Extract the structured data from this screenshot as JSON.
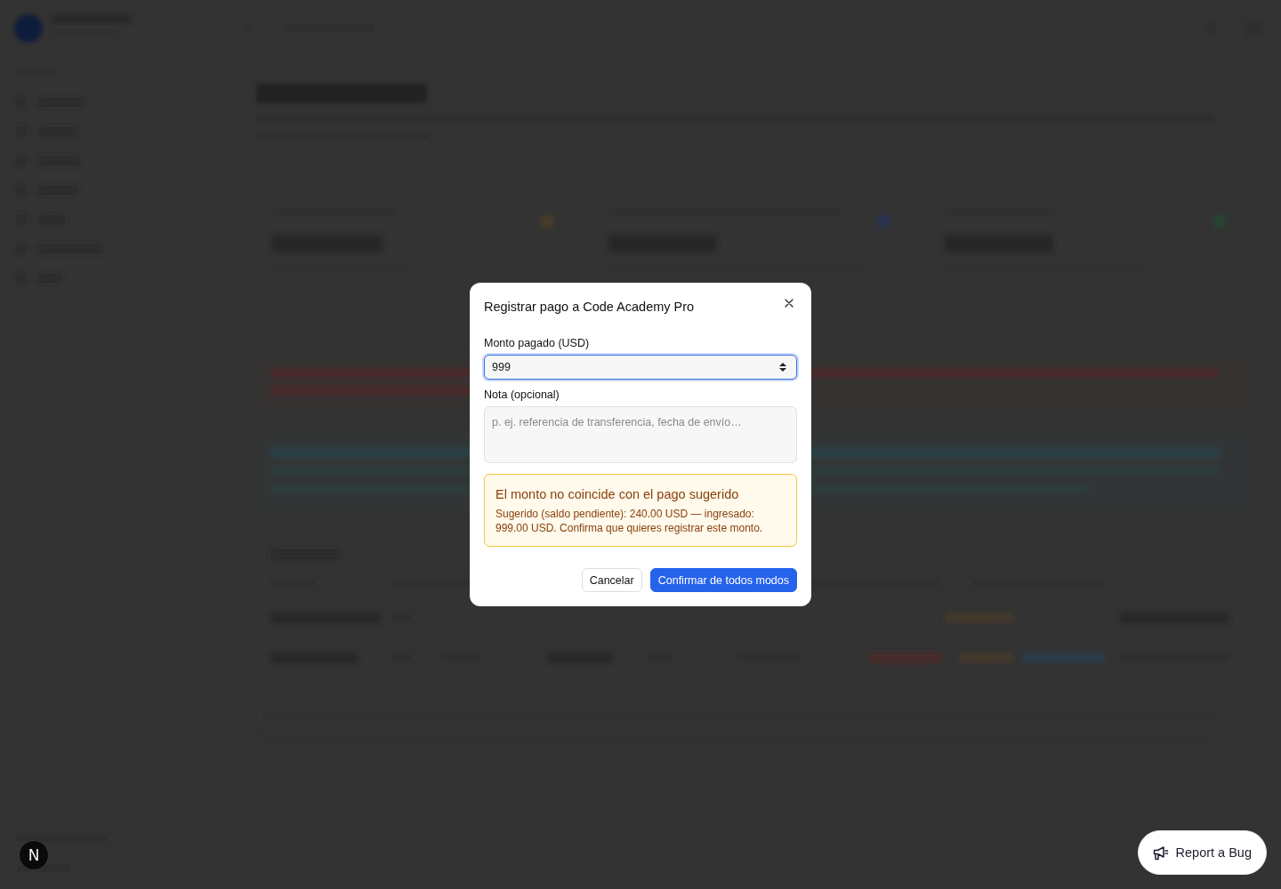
{
  "dialog": {
    "title": "Registrar pago a Code Academy Pro",
    "fields": [
      {
        "kind": "number",
        "label": "Monto pagado (USD)",
        "value": "999",
        "focused": true
      },
      {
        "kind": "textarea",
        "label": "Nota (opcional)",
        "placeholder": "p. ej. referencia de transferencia, fecha de envío…",
        "focused": false
      }
    ],
    "warning": {
      "title": "El monto no coincide con el pago sugerido",
      "text": "Sugerido (saldo pendiente): 240.00 USD — ingresado: 999.00 USD. Confirma que quieres registrar este monto."
    },
    "buttons": [
      {
        "kind": "secondary",
        "label": "Cancelar"
      },
      {
        "kind": "primary",
        "label": "Confirmar de todos modos"
      }
    ]
  },
  "dev_badge": {
    "label": "N"
  },
  "report_button": {
    "label": "Report a Bug"
  }
}
